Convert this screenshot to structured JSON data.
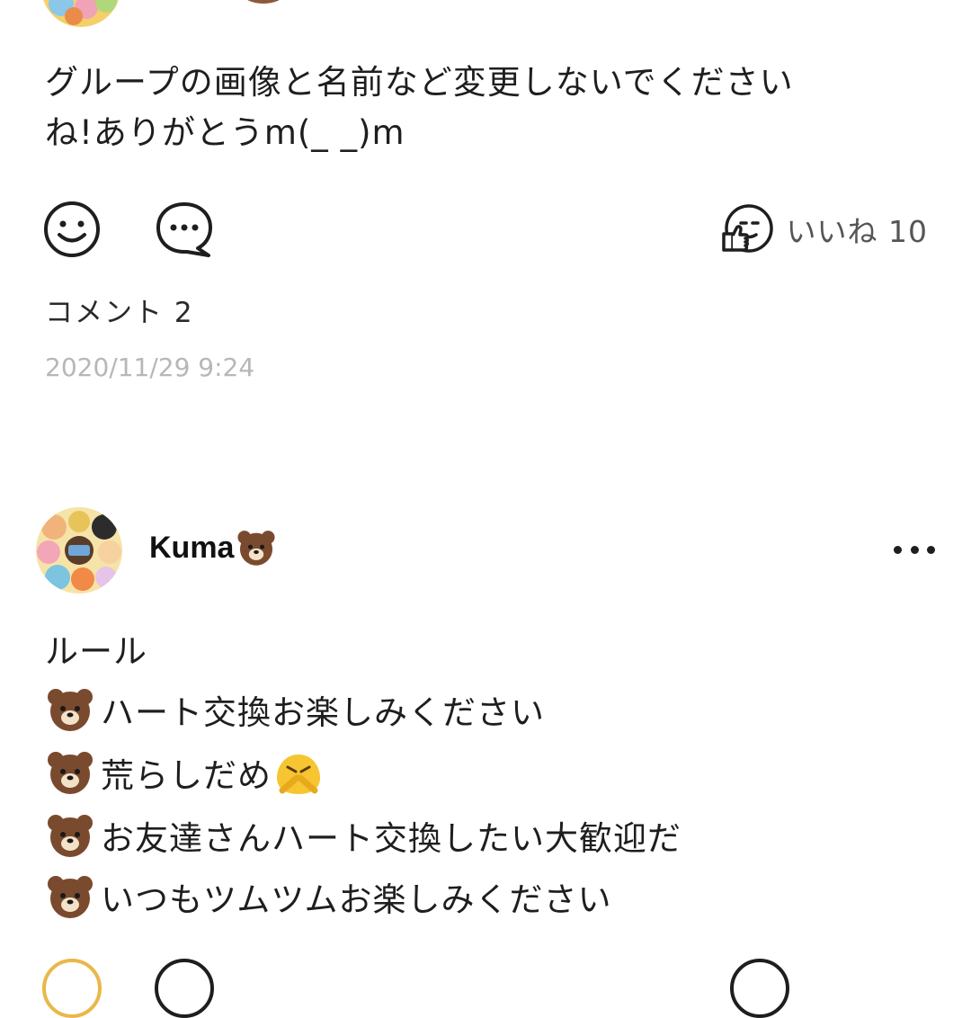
{
  "post1": {
    "text_line1": "グループの画像と名前など変更しないでください",
    "text_line2": "ね!ありがとうm(_ _)m",
    "like_label": "いいね 10",
    "comments_label": "コメント 2",
    "timestamp": "2020/11/29 9:24"
  },
  "post2": {
    "username": "Kuma",
    "rules_title": "ルール",
    "rules": [
      "ハート交換お楽しみください",
      "荒らしだめ",
      "お友達さんハート交換したい大歓迎だ",
      "いつもツムツムお楽しみください"
    ]
  },
  "icons": {
    "smile": "smile-reaction-icon",
    "comment": "comment-bubble-icon",
    "like": "thumbs-up-face-icon",
    "more": "more-dots-icon",
    "bear": "brown-bear-emoji-icon",
    "angry": "angry-face-emoji-icon"
  },
  "colors": {
    "text": "#1e1e1e",
    "muted": "#b4b8b6",
    "bear_brown": "#7a4a2e"
  }
}
